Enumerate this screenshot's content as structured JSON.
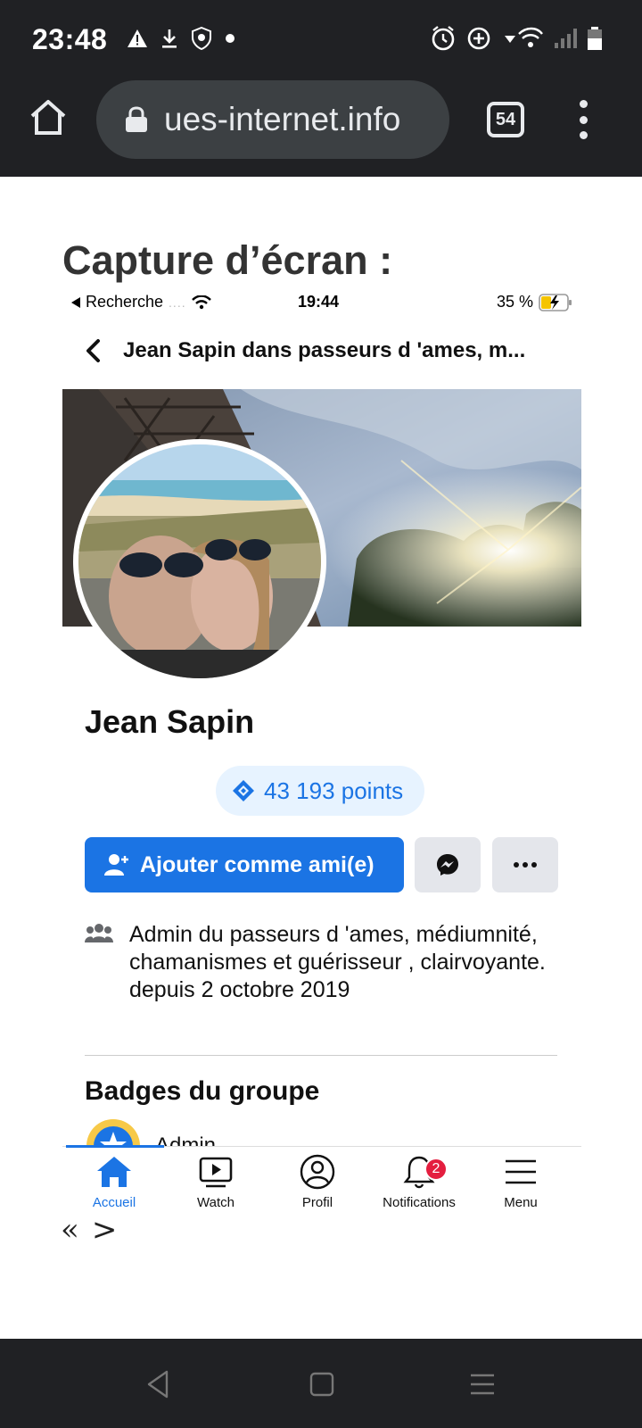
{
  "status_bar": {
    "time": "23:48"
  },
  "browser": {
    "url": "ues-internet.info",
    "tab_count": "54"
  },
  "page": {
    "heading": "Capture d’écran :"
  },
  "screenshot": {
    "ios_status": {
      "back_label": "Recherche",
      "signal_dots": "....",
      "time": "19:44",
      "battery": "35 %"
    },
    "post_header": {
      "title": "Jean Sapin dans passeurs d 'ames, m..."
    },
    "profile": {
      "name": "Jean Sapin",
      "points": "43 193 points",
      "add_friend_label": "Ajouter comme ami(e)"
    },
    "admin_info": {
      "prefix": "Admin du ",
      "group": "passeurs d 'ames, médiumnité, chamanismes et guérisseur , clairvoyante.",
      "suffix": " depuis 2 octobre 2019"
    },
    "badges": {
      "title": "Badges du groupe",
      "first_badge": "Admin"
    },
    "tabbar": {
      "items": [
        {
          "label": "Accueil",
          "icon": "home-icon"
        },
        {
          "label": "Watch",
          "icon": "watch-icon"
        },
        {
          "label": "Profil",
          "icon": "profile-icon"
        },
        {
          "label": "Notifications",
          "icon": "bell-icon"
        },
        {
          "label": "Menu",
          "icon": "menu-icon"
        }
      ],
      "notification_count": "2"
    }
  },
  "pager": {
    "prev": "«",
    "next": ">"
  },
  "colors": {
    "fb_blue": "#1b74e4",
    "points_bg": "#e7f3ff",
    "notif_red": "#e41e3f",
    "chrome_bg": "#202124"
  }
}
